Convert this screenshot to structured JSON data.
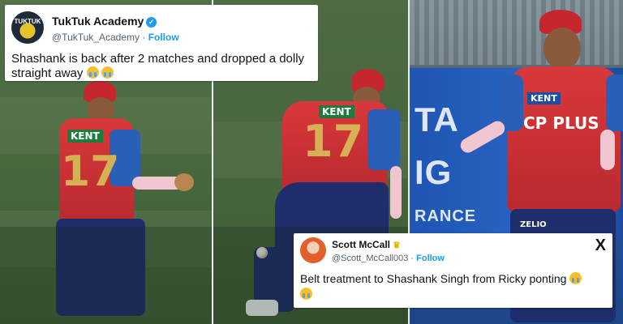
{
  "tweet_top": {
    "avatar_text": "TUKTUK",
    "name": "TukTuk Academy",
    "handle": "@TukTuk_Academy",
    "separator": "·",
    "follow": "Follow",
    "text": "Shashank is back after 2 matches and dropped a dolly straight away",
    "emoji_count": 2,
    "verified": true
  },
  "tweet_bottom": {
    "name": "Scott McCall",
    "handle": "@Scott_McCall003",
    "separator": "·",
    "follow": "Follow",
    "text": "Belt treatment to Shashank Singh from Ricky ponting",
    "emoji_count": 2,
    "platform_icon": "x-logo-icon",
    "x_glyph": "X"
  },
  "frame_right": {
    "jersey_sponsor": "CP PLUS",
    "chest_logo": "KENT",
    "board_text_1": "TA",
    "board_text_2": "IG",
    "board_text_3": "RANCE",
    "pants_logo": "ZELIO"
  },
  "frame_left": {
    "jersey_logo": "KENT",
    "number": "17"
  },
  "frame_mid": {
    "jersey_logo": "KENT",
    "number": "17"
  },
  "colors": {
    "twitter_blue": "#1d9bf0",
    "jersey_red": "#d9383a",
    "jersey_blue": "#2a5fb8"
  }
}
